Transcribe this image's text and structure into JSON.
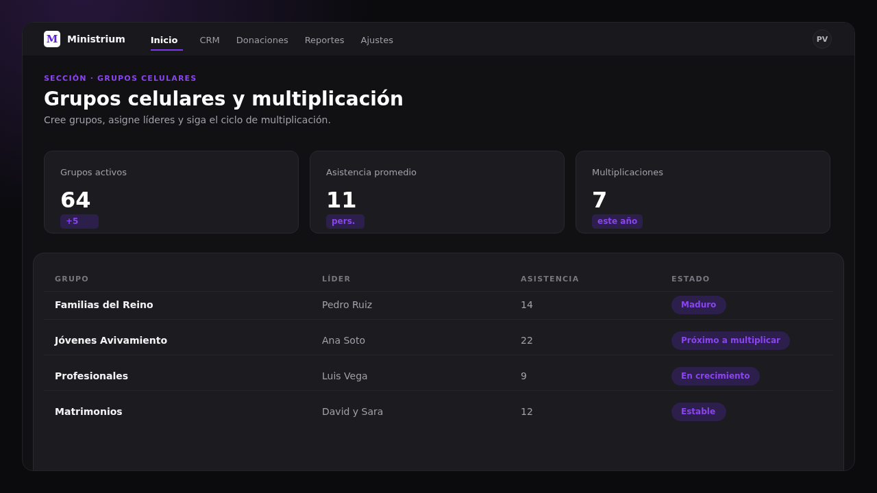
{
  "app": {
    "logo_letter": "M",
    "brand": "Ministrium"
  },
  "nav": {
    "tabs": [
      {
        "label": "Inicio",
        "selected": true
      },
      {
        "label": "CRM",
        "selected": false
      },
      {
        "label": "Donaciones",
        "selected": false
      },
      {
        "label": "Reportes",
        "selected": false
      },
      {
        "label": "Ajustes",
        "selected": false
      }
    ]
  },
  "user": {
    "initials": "PV"
  },
  "header": {
    "eyebrow": "SECCIÓN · GRUPOS CELULARES",
    "title": "Grupos celulares y multiplicación",
    "subtitle": "Cree grupos, asigne líderes y siga el ciclo de multiplicación."
  },
  "stats": [
    {
      "label": "Grupos activos",
      "value": "64",
      "badge": "+5"
    },
    {
      "label": "Asistencia promedio",
      "value": "11",
      "badge": "pers."
    },
    {
      "label": "Multiplicaciones",
      "value": "7",
      "badge": "este año"
    }
  ],
  "table": {
    "columns": [
      "GRUPO",
      "LÍDER",
      "ASISTENCIA",
      "ESTADO"
    ],
    "rows": [
      {
        "group": "Familias del Reino",
        "leader": "Pedro Ruiz",
        "attendance": "14",
        "status": "Maduro"
      },
      {
        "group": "Jóvenes Avivamiento",
        "leader": "Ana Soto",
        "attendance": "22",
        "status": "Próximo a multiplicar"
      },
      {
        "group": "Profesionales",
        "leader": "Luis Vega",
        "attendance": "9",
        "status": "En crecimiento"
      },
      {
        "group": "Matrimonios",
        "leader": "David y Sara",
        "attendance": "12",
        "status": "Estable"
      }
    ]
  }
}
